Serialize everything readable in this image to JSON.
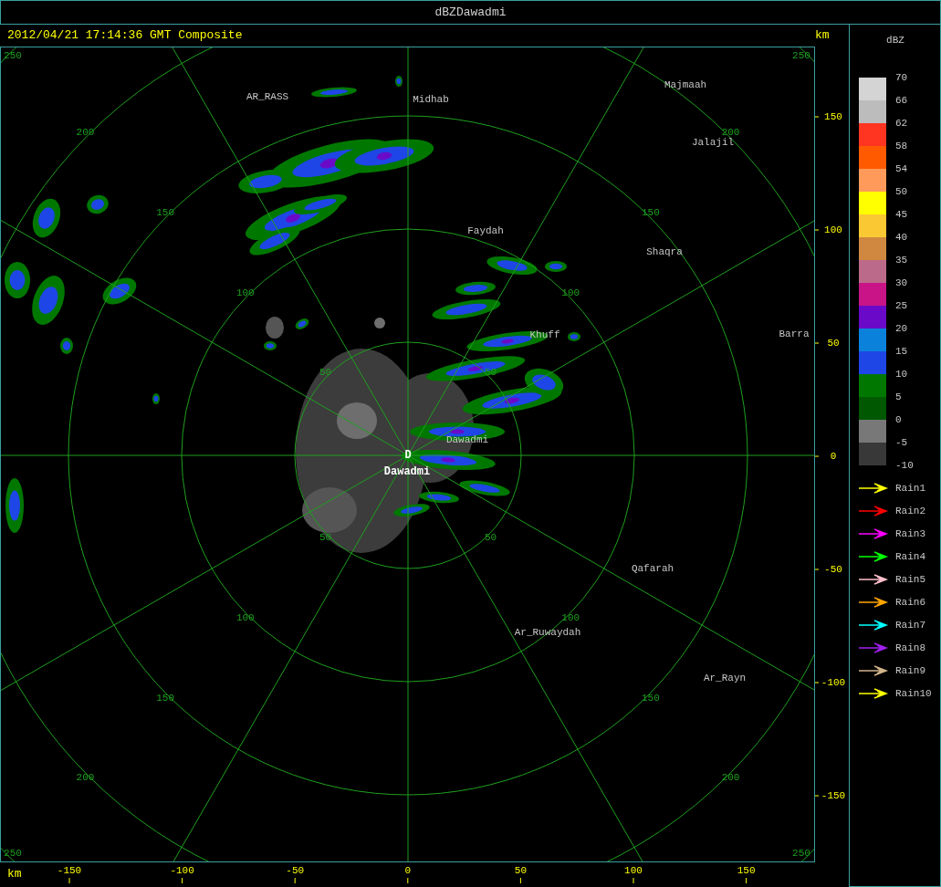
{
  "window": {
    "title": "dBZDawadmi"
  },
  "header": {
    "timestamp": "2012/04/21 17:14:36 GMT Composite",
    "unit": "km"
  },
  "radar": {
    "site_marker": "D",
    "range_labels": [
      {
        "labels": [
          "250",
          "200",
          "150",
          "100",
          "50"
        ]
      },
      {
        "labels": [
          "250",
          "200",
          "150",
          "100",
          "50"
        ]
      },
      {
        "labels": [
          "50",
          "100",
          "150",
          "200",
          "250"
        ]
      },
      {
        "labels": [
          "50",
          "100",
          "150",
          "200",
          "250"
        ]
      }
    ],
    "places": [
      {
        "name": "AR_RASS",
        "kind": "town"
      },
      {
        "name": "Midhab",
        "kind": "town"
      },
      {
        "name": "Majmaah",
        "kind": "town"
      },
      {
        "name": "Jalajil",
        "kind": "town"
      },
      {
        "name": "Faydah",
        "kind": "town"
      },
      {
        "name": "Shaqra",
        "kind": "town"
      },
      {
        "name": "Khuff",
        "kind": "town"
      },
      {
        "name": "Barra",
        "kind": "town"
      },
      {
        "name": "Dawadmi",
        "kind": "town"
      },
      {
        "name": "Dawadmi",
        "kind": "site"
      },
      {
        "name": "Qafarah",
        "kind": "town"
      },
      {
        "name": "Ar_Ruwaydah",
        "kind": "town"
      },
      {
        "name": "Ar_Rayn",
        "kind": "town"
      }
    ]
  },
  "y_axis": {
    "ticks": [
      "150",
      "100",
      "50",
      "0",
      "-50",
      "-100",
      "-150"
    ]
  },
  "x_axis": {
    "unit": "km",
    "ticks": [
      "-150",
      "-100",
      "-50",
      "0",
      "50",
      "100",
      "150"
    ]
  },
  "legend": {
    "title": "dBZ",
    "bins": [
      {
        "color": "#d4d4d4"
      },
      {
        "color": "#bcbcbc"
      },
      {
        "color": "#ff3522"
      },
      {
        "color": "#ff5a00"
      },
      {
        "color": "#ff9a5a"
      },
      {
        "color": "#ffff00"
      },
      {
        "color": "#fac832"
      },
      {
        "color": "#d08840"
      },
      {
        "color": "#bc6a8a"
      },
      {
        "color": "#c81487"
      },
      {
        "color": "#6a0ac8"
      },
      {
        "color": "#0a82dc"
      },
      {
        "color": "#1e46e6"
      },
      {
        "color": "#007800"
      },
      {
        "color": "#005800"
      },
      {
        "color": "#787878"
      },
      {
        "color": "#383838"
      }
    ],
    "labels": [
      "70",
      "66",
      "62",
      "58",
      "54",
      "50",
      "45",
      "40",
      "35",
      "30",
      "25",
      "20",
      "15",
      "10",
      "5",
      "0",
      "-5",
      "-10"
    ],
    "tracks": [
      {
        "label": "Rain1",
        "color": "#ffff00"
      },
      {
        "label": "Rain2",
        "color": "#ff0000"
      },
      {
        "label": "Rain3",
        "color": "#ff00ff"
      },
      {
        "label": "Rain4",
        "color": "#00ff00"
      },
      {
        "label": "Rain5",
        "color": "#ffc0cb"
      },
      {
        "label": "Rain6",
        "color": "#ffa500"
      },
      {
        "label": "Rain7",
        "color": "#00ffff"
      },
      {
        "label": "Rain8",
        "color": "#a020f0"
      },
      {
        "label": "Rain9",
        "color": "#d2b48c"
      },
      {
        "label": "Rain10",
        "color": "#ffff00"
      }
    ]
  }
}
